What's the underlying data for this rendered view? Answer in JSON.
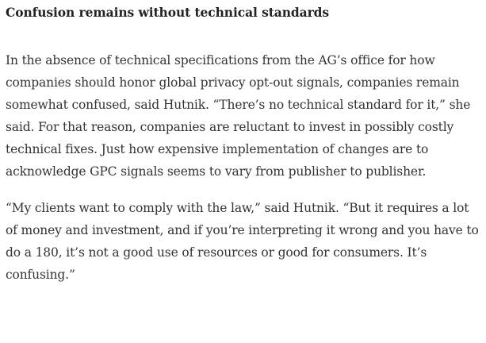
{
  "article": {
    "heading": "Confusion remains without technical standards",
    "paragraphs": [
      "In the absence of technical specifications from the AG’s office for how companies should honor global privacy opt-out signals, companies remain somewhat confused, said Hutnik. “There’s no technical standard for it,” she said. For that reason, companies are reluctant to invest in possibly costly technical fixes. Just how expensive implementation of changes are to acknowledge GPC signals seems to vary from publisher to publisher.",
      "“My clients want to comply with the law,” said Hutnik. “But it requires a lot of money and investment, and if you’re interpreting it wrong and you have to do a 180, it’s not a good use of resources or good for consumers. It’s confusing.”"
    ]
  }
}
